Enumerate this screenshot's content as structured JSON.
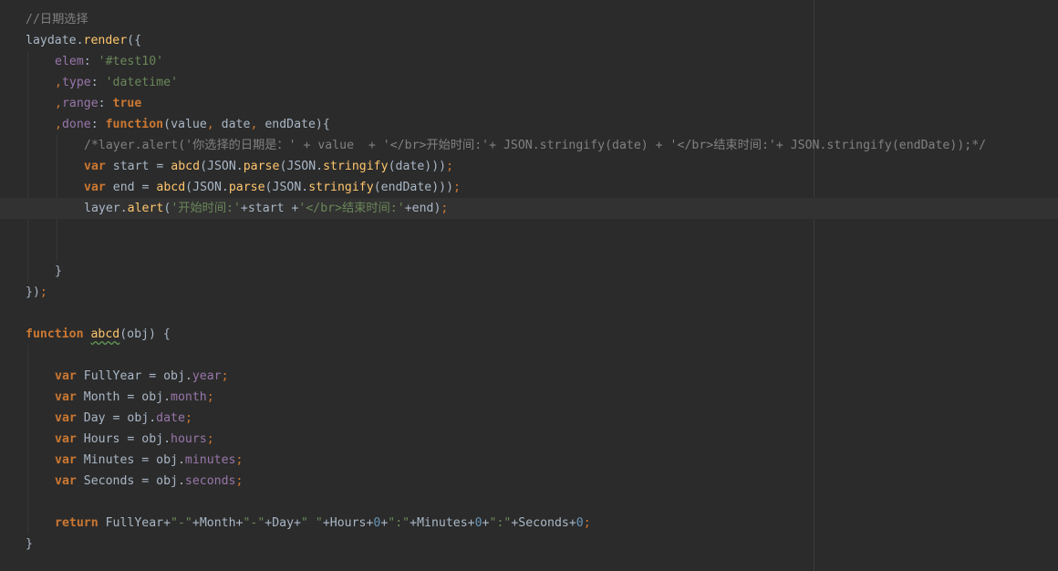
{
  "editor": {
    "colors": {
      "background": "#2b2b2b",
      "current_line": "#323232",
      "default": "#a9b7c6",
      "comment": "#808080",
      "keyword": "#cc7832",
      "function": "#ffc66d",
      "property": "#9876aa",
      "string": "#6a8759",
      "number": "#6897bb"
    },
    "current_line_index": 9,
    "lines": [
      {
        "tokens": [
          {
            "t": "//日期选择",
            "c": "comment"
          }
        ]
      },
      {
        "tokens": [
          {
            "t": "laydate",
            "c": "default"
          },
          {
            "t": ".",
            "c": "default"
          },
          {
            "t": "render",
            "c": "fn"
          },
          {
            "t": "({",
            "c": "default"
          }
        ]
      },
      {
        "tokens": [
          {
            "t": "elem",
            "c": "prop"
          },
          {
            "t": ": ",
            "c": "default"
          },
          {
            "t": "'#test10'",
            "c": "string"
          }
        ]
      },
      {
        "tokens": [
          {
            "t": ",",
            "c": "punct"
          },
          {
            "t": "type",
            "c": "prop"
          },
          {
            "t": ": ",
            "c": "default"
          },
          {
            "t": "'datetime'",
            "c": "string"
          }
        ]
      },
      {
        "tokens": [
          {
            "t": ",",
            "c": "punct"
          },
          {
            "t": "range",
            "c": "prop"
          },
          {
            "t": ": ",
            "c": "default"
          },
          {
            "t": "true",
            "c": "literal"
          }
        ]
      },
      {
        "tokens": [
          {
            "t": ",",
            "c": "punct"
          },
          {
            "t": "done",
            "c": "prop"
          },
          {
            "t": ": ",
            "c": "default"
          },
          {
            "t": "function",
            "c": "keyword"
          },
          {
            "t": "(value",
            "c": "default"
          },
          {
            "t": ", ",
            "c": "punct"
          },
          {
            "t": "date",
            "c": "default"
          },
          {
            "t": ", ",
            "c": "punct"
          },
          {
            "t": "endDate){",
            "c": "default"
          }
        ]
      },
      {
        "tokens": [
          {
            "t": "/*layer.alert('你选择的日期是：' + value  + '</br>开始时间:'+ JSON.stringify(date) + '</br>结束时间:'+ JSON.stringify(endDate));*/",
            "c": "comment"
          }
        ]
      },
      {
        "tokens": [
          {
            "t": "var ",
            "c": "keyword"
          },
          {
            "t": "start = ",
            "c": "default"
          },
          {
            "t": "abcd",
            "c": "fn"
          },
          {
            "t": "(",
            "c": "default"
          },
          {
            "t": "JSON",
            "c": "default"
          },
          {
            "t": ".",
            "c": "default"
          },
          {
            "t": "parse",
            "c": "fn"
          },
          {
            "t": "(",
            "c": "default"
          },
          {
            "t": "JSON",
            "c": "default"
          },
          {
            "t": ".",
            "c": "default"
          },
          {
            "t": "stringify",
            "c": "fn"
          },
          {
            "t": "(date)))",
            "c": "default"
          },
          {
            "t": ";",
            "c": "punct"
          }
        ]
      },
      {
        "tokens": [
          {
            "t": "var ",
            "c": "keyword"
          },
          {
            "t": "end = ",
            "c": "default"
          },
          {
            "t": "abcd",
            "c": "fn"
          },
          {
            "t": "(",
            "c": "default"
          },
          {
            "t": "JSON",
            "c": "default"
          },
          {
            "t": ".",
            "c": "default"
          },
          {
            "t": "parse",
            "c": "fn"
          },
          {
            "t": "(",
            "c": "default"
          },
          {
            "t": "JSON",
            "c": "default"
          },
          {
            "t": ".",
            "c": "default"
          },
          {
            "t": "stringify",
            "c": "fn"
          },
          {
            "t": "(endDate)))",
            "c": "default"
          },
          {
            "t": ";",
            "c": "punct"
          }
        ]
      },
      {
        "tokens": [
          {
            "t": "layer",
            "c": "default"
          },
          {
            "t": ".",
            "c": "default"
          },
          {
            "t": "alert",
            "c": "fn"
          },
          {
            "t": "(",
            "c": "default"
          },
          {
            "t": "'开始时间:'",
            "c": "string"
          },
          {
            "t": "+start +",
            "c": "default"
          },
          {
            "t": "'</br>结束时间:'",
            "c": "string"
          },
          {
            "t": "+end)",
            "c": "default"
          },
          {
            "t": ";",
            "c": "punct"
          }
        ]
      },
      {
        "tokens": []
      },
      {
        "tokens": []
      },
      {
        "tokens": [
          {
            "t": "}",
            "c": "default"
          }
        ]
      },
      {
        "tokens": [
          {
            "t": "})",
            "c": "default"
          },
          {
            "t": ";",
            "c": "punct"
          }
        ]
      },
      {
        "tokens": []
      },
      {
        "tokens": [
          {
            "t": "function ",
            "c": "keyword"
          },
          {
            "t": "abcd",
            "c": "fn",
            "warn": true
          },
          {
            "t": "(obj) {",
            "c": "default"
          }
        ]
      },
      {
        "tokens": []
      },
      {
        "tokens": [
          {
            "t": "var ",
            "c": "keyword"
          },
          {
            "t": "FullYear = obj.",
            "c": "default"
          },
          {
            "t": "year",
            "c": "prop"
          },
          {
            "t": ";",
            "c": "punct"
          }
        ]
      },
      {
        "tokens": [
          {
            "t": "var ",
            "c": "keyword"
          },
          {
            "t": "Month = obj.",
            "c": "default"
          },
          {
            "t": "month",
            "c": "prop"
          },
          {
            "t": ";",
            "c": "punct"
          }
        ]
      },
      {
        "tokens": [
          {
            "t": "var ",
            "c": "keyword"
          },
          {
            "t": "Day = obj.",
            "c": "default"
          },
          {
            "t": "date",
            "c": "prop"
          },
          {
            "t": ";",
            "c": "punct"
          }
        ]
      },
      {
        "tokens": [
          {
            "t": "var ",
            "c": "keyword"
          },
          {
            "t": "Hours = obj.",
            "c": "default"
          },
          {
            "t": "hours",
            "c": "prop"
          },
          {
            "t": ";",
            "c": "punct"
          }
        ]
      },
      {
        "tokens": [
          {
            "t": "var ",
            "c": "keyword"
          },
          {
            "t": "Minutes = obj.",
            "c": "default"
          },
          {
            "t": "minutes",
            "c": "prop"
          },
          {
            "t": ";",
            "c": "punct"
          }
        ]
      },
      {
        "tokens": [
          {
            "t": "var ",
            "c": "keyword"
          },
          {
            "t": "Seconds = obj.",
            "c": "default"
          },
          {
            "t": "seconds",
            "c": "prop"
          },
          {
            "t": ";",
            "c": "punct"
          }
        ]
      },
      {
        "tokens": []
      },
      {
        "tokens": [
          {
            "t": "return ",
            "c": "keyword"
          },
          {
            "t": "FullYear+",
            "c": "default"
          },
          {
            "t": "\"-\"",
            "c": "string"
          },
          {
            "t": "+Month+",
            "c": "default"
          },
          {
            "t": "\"-\"",
            "c": "string"
          },
          {
            "t": "+Day+",
            "c": "default"
          },
          {
            "t": "\" \"",
            "c": "string"
          },
          {
            "t": "+Hours+",
            "c": "default"
          },
          {
            "t": "0",
            "c": "number"
          },
          {
            "t": "+",
            "c": "default"
          },
          {
            "t": "\":\"",
            "c": "string"
          },
          {
            "t": "+Minutes+",
            "c": "default"
          },
          {
            "t": "0",
            "c": "number"
          },
          {
            "t": "+",
            "c": "default"
          },
          {
            "t": "\":\"",
            "c": "string"
          },
          {
            "t": "+Seconds+",
            "c": "default"
          },
          {
            "t": "0",
            "c": "number"
          },
          {
            "t": ";",
            "c": "punct"
          }
        ]
      },
      {
        "tokens": [
          {
            "t": "}",
            "c": "default"
          }
        ]
      }
    ]
  }
}
